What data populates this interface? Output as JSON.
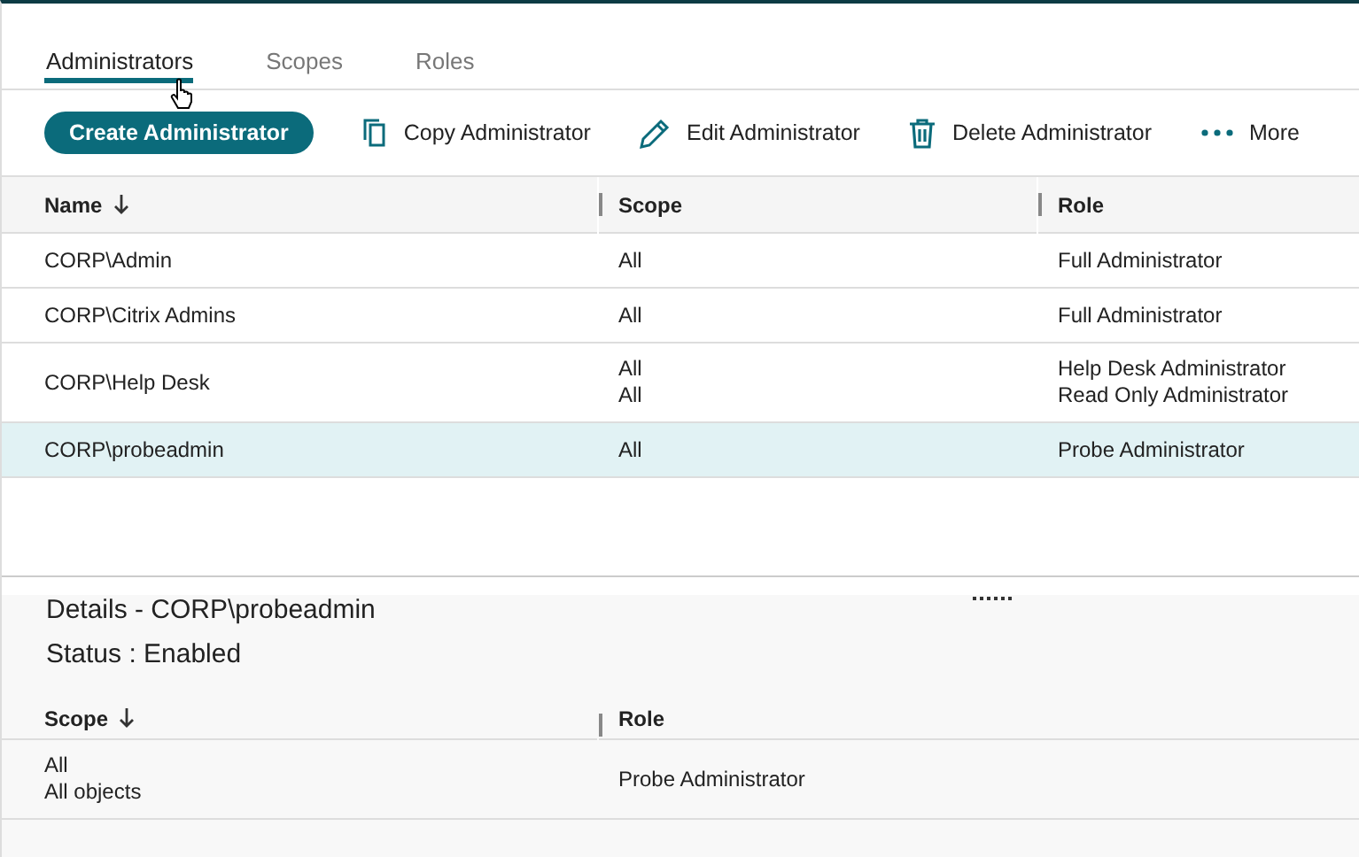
{
  "tabs": [
    {
      "label": "Administrators",
      "selected": true
    },
    {
      "label": "Scopes",
      "selected": false
    },
    {
      "label": "Roles",
      "selected": false
    }
  ],
  "toolbar": {
    "primary": "Create Administrator",
    "actions": [
      {
        "kind": "copy",
        "label": "Copy Administrator"
      },
      {
        "kind": "edit",
        "label": "Edit Administrator"
      },
      {
        "kind": "delete",
        "label": "Delete Administrator"
      },
      {
        "kind": "more",
        "label": "More"
      }
    ]
  },
  "table": {
    "columns": [
      {
        "label": "Name",
        "sorted": true
      },
      {
        "label": "Scope",
        "sorted": false
      },
      {
        "label": "Role",
        "sorted": false
      }
    ],
    "rows": [
      {
        "name": "CORP\\Admin",
        "scopes": [
          "All"
        ],
        "roles": [
          "Full Administrator"
        ],
        "selected": false
      },
      {
        "name": "CORP\\Citrix Admins",
        "scopes": [
          "All"
        ],
        "roles": [
          "Full Administrator"
        ],
        "selected": false
      },
      {
        "name": "CORP\\Help Desk",
        "scopes": [
          "All",
          "All"
        ],
        "roles": [
          "Help Desk Administrator",
          "Read Only Administrator"
        ],
        "selected": false
      },
      {
        "name": "CORP\\probeadmin",
        "scopes": [
          "All"
        ],
        "roles": [
          "Probe Administrator"
        ],
        "selected": true
      }
    ]
  },
  "details": {
    "title": "Details - CORP\\probeadmin",
    "status": "Status : Enabled",
    "columns": [
      {
        "label": "Scope",
        "sorted": true
      },
      {
        "label": "Role",
        "sorted": false
      }
    ],
    "rows": [
      {
        "scope": [
          "All",
          "All objects"
        ],
        "role": "Probe Administrator"
      }
    ]
  }
}
